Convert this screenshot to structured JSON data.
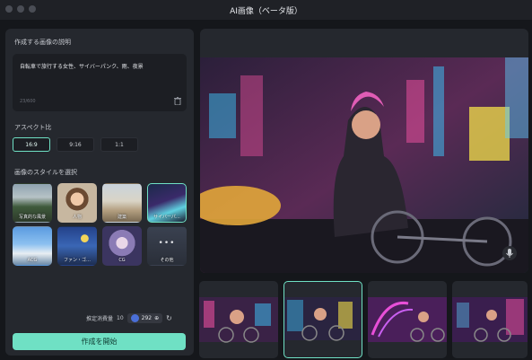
{
  "window": {
    "title": "AI画像（ベータ版）"
  },
  "prompt": {
    "label": "作成する画像の説明",
    "text": "自転車で旅行する女性、サイバーパンク、雨、夜景",
    "counter": "23/600"
  },
  "aspect": {
    "label": "アスペクト比",
    "options": [
      "16:9",
      "9:16",
      "1:1"
    ],
    "selected": "16:9"
  },
  "styles": {
    "label": "画像のスタイルを選択",
    "items": [
      {
        "label": "写真的な風景",
        "icon": "landscape-photo"
      },
      {
        "label": "人物",
        "icon": "portrait-photo"
      },
      {
        "label": "建築",
        "icon": "architecture"
      },
      {
        "label": "サイバーパ…",
        "icon": "cyberpunk"
      },
      {
        "label": "ACG",
        "icon": "anime-sky"
      },
      {
        "label": "ファン・ゴ…",
        "icon": "van-gogh"
      },
      {
        "label": "CG",
        "icon": "cg-character"
      },
      {
        "label": "その他",
        "icon": "more"
      }
    ],
    "selected": "サイバーパ…",
    "more_glyph": "•••"
  },
  "usage": {
    "label": "推定消費量",
    "cost": "10",
    "balance": "292"
  },
  "create_button": "作成を開始",
  "colors": {
    "accent": "#6fe0c4",
    "panel": "#25282e",
    "background": "#15171b"
  }
}
